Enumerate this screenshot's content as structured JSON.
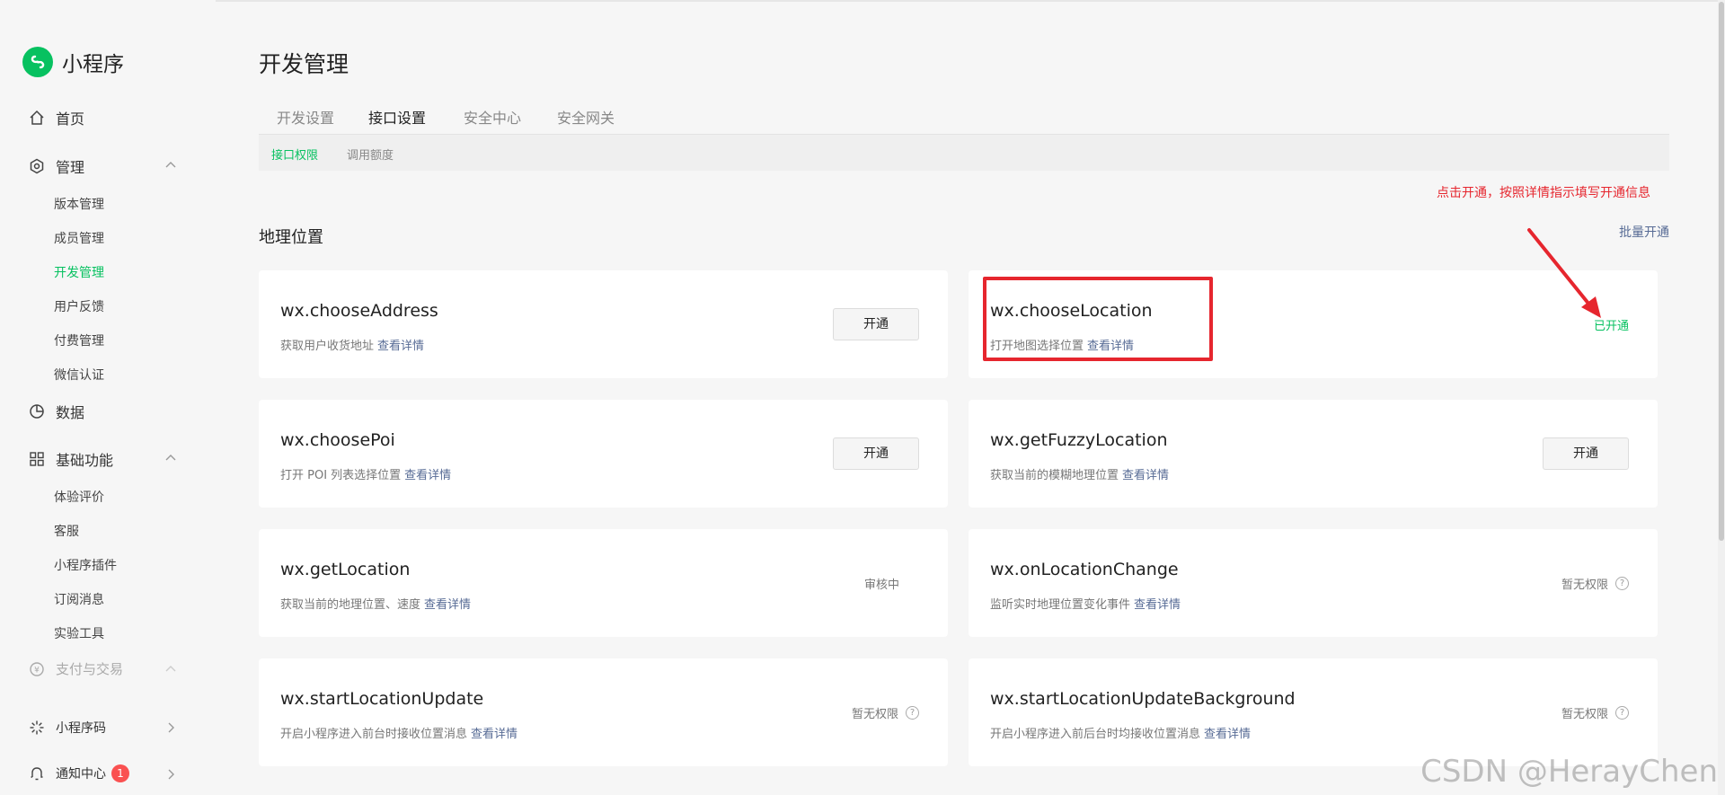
{
  "brand": {
    "name": "小程序"
  },
  "sidebar": {
    "home": "首页",
    "manage": "管理",
    "manage_items": [
      "版本管理",
      "成员管理",
      "开发管理",
      "用户反馈",
      "付费管理",
      "微信认证"
    ],
    "data": "数据",
    "basic": "基础功能",
    "basic_items": [
      "体验评价",
      "客服",
      "小程序插件",
      "订阅消息",
      "实验工具"
    ],
    "pay": "支付与交易",
    "qrcode": "小程序码",
    "notify": "通知中心",
    "notify_badge": "1"
  },
  "page": {
    "title": "开发管理",
    "tabs": [
      "开发设置",
      "接口设置",
      "安全中心",
      "安全网关"
    ],
    "active_tab": "接口设置",
    "subtabs": [
      "接口权限",
      "调用额度"
    ],
    "active_subtab": "接口权限",
    "annotation": "点击开通，按照详情指示填写开通信息",
    "section_title": "地理位置",
    "batch_link": "批量开通"
  },
  "cards": [
    {
      "name": "wx.chooseAddress",
      "desc": "获取用户收货地址",
      "more": "查看详情",
      "action": "开通"
    },
    {
      "name": "wx.chooseLocation",
      "desc": "打开地图选择位置",
      "more": "查看详情",
      "status": "已开通"
    },
    {
      "name": "wx.choosePoi",
      "desc": "打开 POI 列表选择位置",
      "more": "查看详情",
      "action": "开通"
    },
    {
      "name": "wx.getFuzzyLocation",
      "desc": "获取当前的模糊地理位置",
      "more": "查看详情",
      "action": "开通"
    },
    {
      "name": "wx.getLocation",
      "desc": "获取当前的地理位置、速度",
      "more": "查看详情",
      "status": "审核中"
    },
    {
      "name": "wx.onLocationChange",
      "desc": "监听实时地理位置变化事件",
      "more": "查看详情",
      "status": "暂无权限"
    },
    {
      "name": "wx.startLocationUpdate",
      "desc": "开启小程序进入前台时接收位置消息",
      "more": "查看详情",
      "status": "暂无权限"
    },
    {
      "name": "wx.startLocationUpdateBackground",
      "desc": "开启小程序进入前后台时均接收位置消息",
      "more": "查看详情",
      "status": "暂无权限"
    }
  ],
  "watermark": "CSDN @HerayChen",
  "colors": {
    "accent": "#07c160",
    "link": "#576b95",
    "alert": "#e6262e"
  }
}
